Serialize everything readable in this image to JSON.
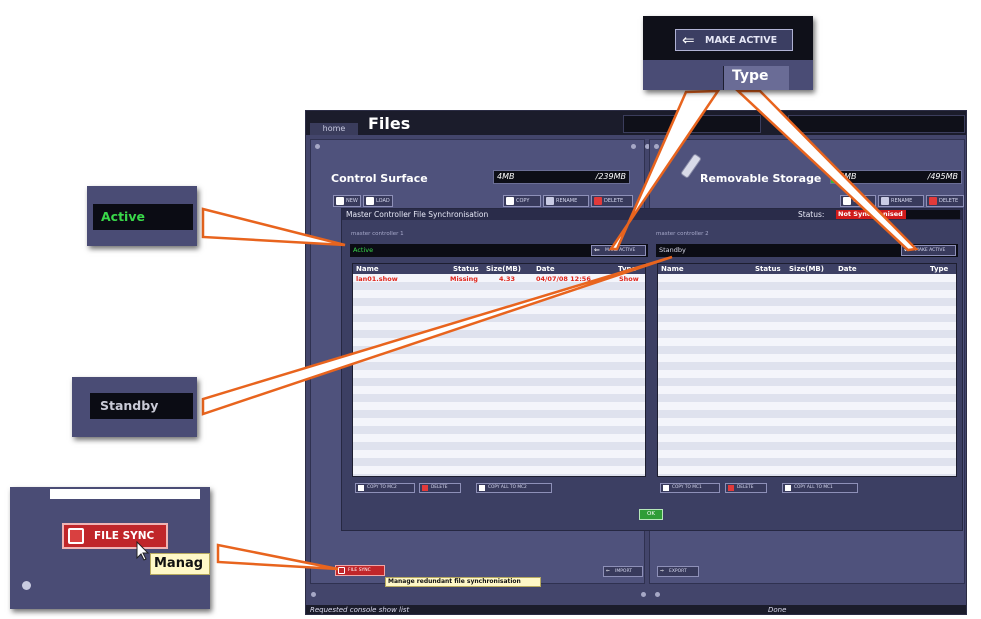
{
  "window": {
    "home_tab": "home",
    "title": "Files"
  },
  "left_panel": {
    "title": "Control Surface",
    "meter_used": "4MB",
    "meter_total": "/239MB",
    "buttons": [
      "NEW",
      "LOAD",
      "COPY",
      "RENAME",
      "DELETE"
    ]
  },
  "right_panel": {
    "title": "Removable Storage",
    "meter_used": "6MB",
    "meter_total": "/495MB",
    "buttons": [
      "COPY",
      "RENAME",
      "DELETE"
    ]
  },
  "dialog": {
    "title": "Master Controller File Synchronisation",
    "status_label": "Status:",
    "status_value": "Not Synchronised",
    "mc1": {
      "label": "master controller 1",
      "state": "Active",
      "make_active": "MAKE ACTIVE",
      "columns": [
        "Name",
        "Status",
        "Size(MB)",
        "Date",
        "Type"
      ],
      "rows": [
        {
          "name": "lan01.show",
          "status": "Missing",
          "size": "4.33",
          "date": "04/07/08 12:56",
          "type": "Show"
        }
      ],
      "buttons": [
        "COPY TO MC2",
        "DELETE",
        "COPY ALL TO MC2"
      ]
    },
    "mc2": {
      "label": "master controller 2",
      "state": "Standby",
      "make_active": "MAKE ACTIVE",
      "columns": [
        "Name",
        "Status",
        "Size(MB)",
        "Date",
        "Type"
      ],
      "buttons": [
        "COPY TO MC1",
        "DELETE",
        "COPY ALL TO MC1"
      ]
    },
    "ok_label": "OK"
  },
  "bottom": {
    "file_sync": "FILE SYNC",
    "tooltip": "Manage redundant file synchronisation",
    "import": "IMPORT",
    "export": "EXPORT"
  },
  "statusbar": {
    "left": "Requested console show list",
    "right": "Done"
  },
  "callouts": {
    "make_active_label": "MAKE ACTIVE",
    "make_active_partial": "Type",
    "active_label": "Active",
    "standby_label": "Standby",
    "file_sync_label": "FILE SYNC",
    "tooltip_partial": "Manag"
  },
  "colors": {
    "active_green": "#39d84a",
    "error_red": "#e0261b",
    "file_sync_red": "#c0262a",
    "callout_line": "#e8641e",
    "ok_green": "#2f9d37"
  }
}
